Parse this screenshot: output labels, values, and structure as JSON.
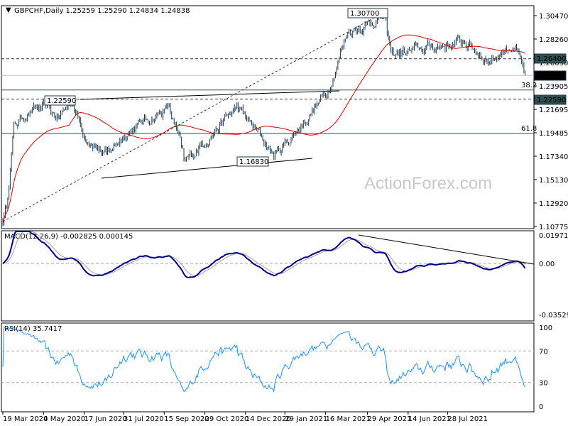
{
  "chart_data": {
    "type": "ohlc",
    "symbol_header": "GBPCHF,Daily  1.25259 1.25290 1.24834 1.24838",
    "ohlc_last": {
      "open": 1.25259,
      "high": 1.2529,
      "low": 1.24834,
      "close": 1.24838
    },
    "price_axis": {
      "ylim": [
        1.10775,
        1.3047
      ],
      "ticks": [
        "1.30470",
        "1.28260",
        "1.26050",
        "1.23905",
        "1.21695",
        "1.19485",
        "1.17340",
        "1.15130",
        "1.12920",
        "1.10775"
      ]
    },
    "price_labels": {
      "current": "1.24838",
      "level_1": "1.26400",
      "level_2": "1.22590"
    },
    "x_ticks": [
      {
        "bar": 0,
        "label": "19 Mar 2020"
      },
      {
        "bar": 33,
        "label": "4 May 2020"
      },
      {
        "bar": 66,
        "label": "17 Jun 2020"
      },
      {
        "bar": 98,
        "label": "31 Jul 2020"
      },
      {
        "bar": 131,
        "label": "15 Sep 2020"
      },
      {
        "bar": 164,
        "label": "29 Oct 2020"
      },
      {
        "bar": 197,
        "label": "14 Dec 2020"
      },
      {
        "bar": 229,
        "label": "29 Jan 2021"
      },
      {
        "bar": 262,
        "label": "16 Mar 2021"
      },
      {
        "bar": 296,
        "label": "29 Apr 2021"
      },
      {
        "bar": 329,
        "label": "14 Jun 2021"
      },
      {
        "bar": 361,
        "label": "28 Jul 2021"
      }
    ],
    "bar_count": 425,
    "approx_close_path": [
      [
        0,
        1.112
      ],
      [
        3,
        1.125
      ],
      [
        9,
        1.2
      ],
      [
        20,
        1.213
      ],
      [
        33,
        1.218
      ],
      [
        45,
        1.208
      ],
      [
        56,
        1.225
      ],
      [
        65,
        1.195
      ],
      [
        84,
        1.172
      ],
      [
        100,
        1.195
      ],
      [
        135,
        1.218
      ],
      [
        146,
        1.175
      ],
      [
        147,
        1.165
      ],
      [
        160,
        1.182
      ],
      [
        190,
        1.218
      ],
      [
        210,
        1.19
      ],
      [
        220,
        1.172
      ],
      [
        240,
        1.198
      ],
      [
        263,
        1.232
      ],
      [
        280,
        1.29
      ],
      [
        300,
        1.299
      ],
      [
        309,
        1.305
      ],
      [
        315,
        1.268
      ],
      [
        340,
        1.273
      ],
      [
        375,
        1.28
      ],
      [
        395,
        1.262
      ],
      [
        415,
        1.278
      ],
      [
        424,
        1.2484
      ]
    ],
    "annotations": {
      "high": {
        "bar": 310,
        "price": 1.307,
        "label": "1.30700"
      },
      "pivot_high": {
        "bar": 35,
        "price": 1.2259,
        "label": "1.22590"
      },
      "pivot_low": {
        "bar": 215,
        "price": 1.1683,
        "label": "1.16830"
      },
      "fib_382": {
        "price": 1.2345,
        "label": "38.2"
      },
      "fib_618": {
        "price": 1.1935,
        "label": "61.8"
      },
      "resistance_dashed": 1.264,
      "support_dashed": 1.2259
    },
    "moving_average_period": 55,
    "macd": {
      "title": "MACD(12,26,9) -0.002825 0.000145",
      "ticks": [
        "0.019718",
        "0.00",
        "-0.035295"
      ],
      "ylim": [
        -0.035295,
        0.019718
      ]
    },
    "rsi": {
      "title": "RSI(14) 35.7417",
      "ticks": [
        "100",
        "70",
        "30",
        "0"
      ],
      "levels": [
        70,
        30
      ]
    },
    "colors": {
      "bars": "#1c3a52",
      "ma": "#e00000",
      "macd": "#00008b",
      "signal": "#a0a0a0",
      "rsi": "#1e90ff",
      "watermark": "#c8c8c8"
    }
  },
  "watermark": "ActionForex.com"
}
